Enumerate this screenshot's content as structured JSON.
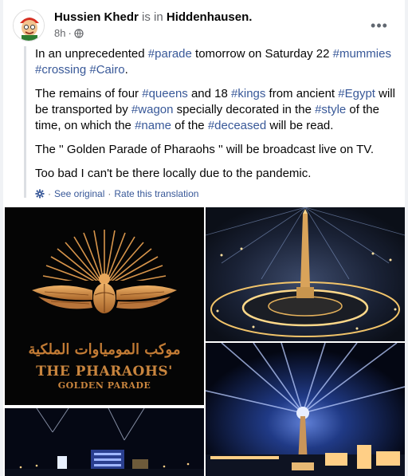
{
  "post": {
    "author": "Hussien Khedr",
    "is_in": "is in",
    "location": "Hiddenhausen.",
    "time": "8h",
    "separator": "·",
    "more_label": "•••",
    "paragraphs": [
      [
        {
          "t": "In an unprecedented ",
          "tag": false
        },
        {
          "t": "#parade",
          "tag": true
        },
        {
          "t": " tomorrow on Saturday 22 ",
          "tag": false
        },
        {
          "t": "#mummies",
          "tag": true
        },
        {
          "t": " ",
          "tag": false
        },
        {
          "t": "#crossing",
          "tag": true
        },
        {
          "t": " ",
          "tag": false
        },
        {
          "t": "#Cairo",
          "tag": true
        },
        {
          "t": ".",
          "tag": false
        }
      ],
      [
        {
          "t": "The remains of four ",
          "tag": false
        },
        {
          "t": "#queens",
          "tag": true
        },
        {
          "t": " and 18 ",
          "tag": false
        },
        {
          "t": "#kings",
          "tag": true
        },
        {
          "t": " from ancient ",
          "tag": false
        },
        {
          "t": "#Egypt",
          "tag": true
        },
        {
          "t": " will be transported by ",
          "tag": false
        },
        {
          "t": "#wagon",
          "tag": true
        },
        {
          "t": " specially decorated in the ",
          "tag": false
        },
        {
          "t": "#style",
          "tag": true
        },
        {
          "t": " of the time, on which the ",
          "tag": false
        },
        {
          "t": "#name",
          "tag": true
        },
        {
          "t": " of the ",
          "tag": false
        },
        {
          "t": "#deceased",
          "tag": true
        },
        {
          "t": " will be read.",
          "tag": false
        }
      ],
      [
        {
          "t": "The '' Golden Parade of Pharaohs '' will be broadcast live on TV.",
          "tag": false
        }
      ],
      [
        {
          "t": "Too bad I can't be there locally due to the pandemic.",
          "tag": false
        }
      ]
    ],
    "see_original": "See original",
    "translation_sep": "·",
    "rate_translation": "Rate this translation"
  },
  "images": {
    "logo_arabic": "موكب المومياوات الملكية",
    "logo_title": "THE PHARAOHS'",
    "logo_subtitle": "GOLDEN PARADE"
  },
  "colors": {
    "link": "#385898",
    "gold": "#c9853e"
  },
  "icons": {
    "globe": "globe-icon",
    "more": "more-options-icon",
    "translate": "translate-gear-icon"
  }
}
